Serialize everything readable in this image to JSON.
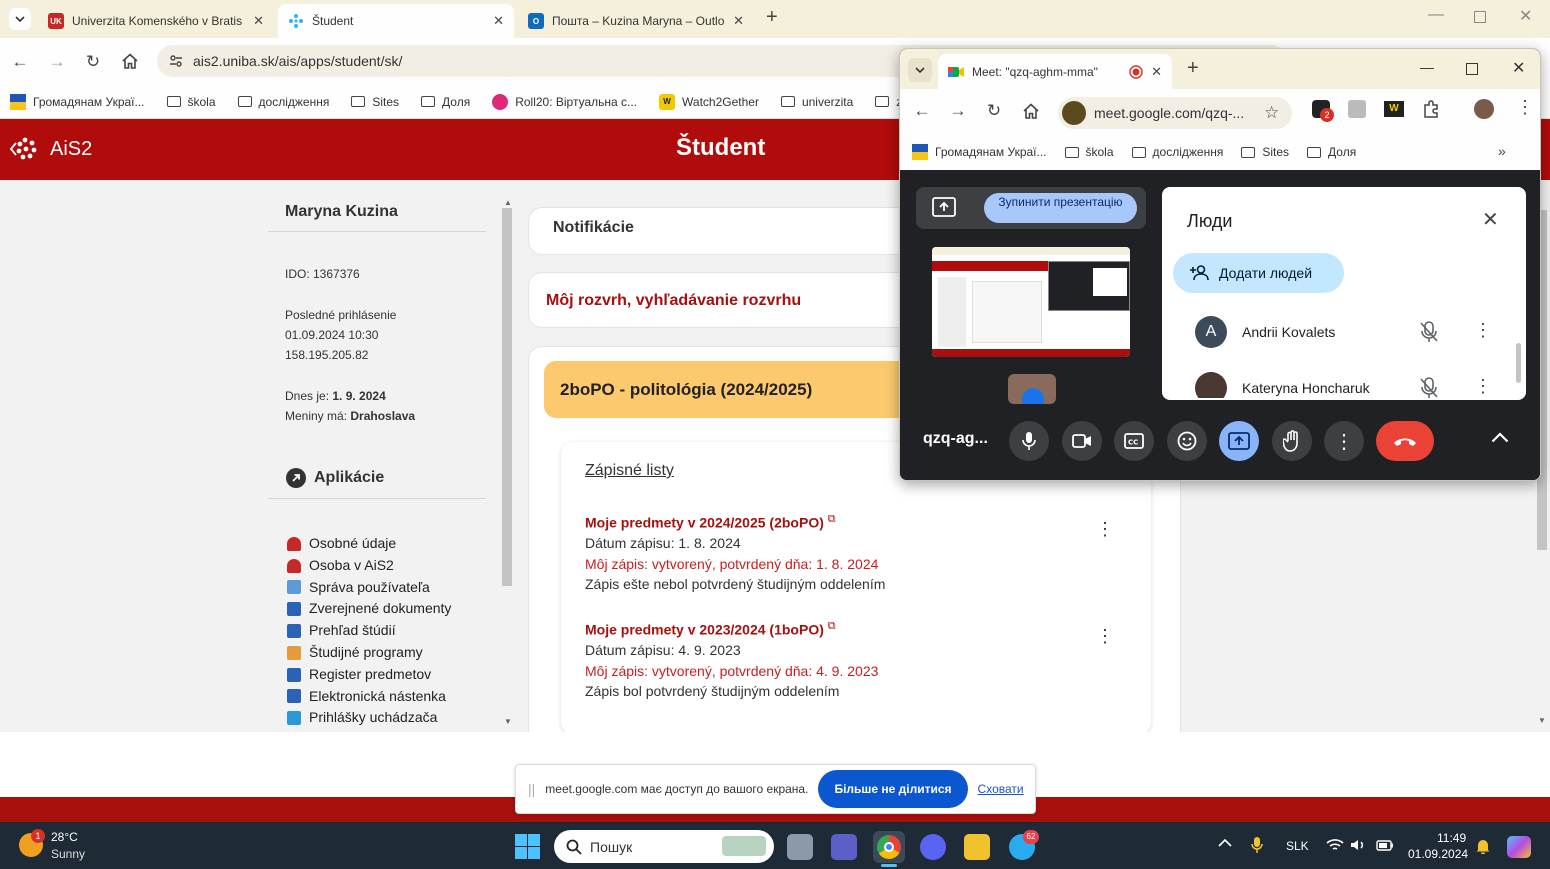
{
  "browser": {
    "tabs": [
      {
        "title": "Univerzita Komenského v Bratis",
        "favicon": "UK",
        "favicon_color": "#c62828"
      },
      {
        "title": "Študent",
        "favicon": "ais2-icon",
        "favicon_color": "#29b6f6"
      },
      {
        "title": "Пошта – Kuzina Maryna – Outlo",
        "favicon": "outlook-icon",
        "favicon_color": "#0f6cbd"
      }
    ],
    "url": "ais2.uniba.sk/ais/apps/student/sk/",
    "bookmarks": [
      "Громадянам Украї...",
      "škola",
      "дослідження",
      "Sites",
      "Доля",
      "Roll20: Віртуальна с...",
      "Watch2Gether",
      "univerzita",
      "zav"
    ]
  },
  "ais": {
    "logo": "AiS2",
    "header_title": "Študent",
    "user": {
      "name": "Maryna Kuzina",
      "ido": "IDO: 1367376",
      "last_login_label": "Posledné prihlásenie",
      "last_login_date": "01.09.2024 10:30",
      "last_login_ip": "158.195.205.82",
      "today_label": "Dnes je:",
      "today": "1. 9. 2024",
      "nameday_label": "Meniny má:",
      "nameday": "Drahoslava"
    },
    "apps_title": "Aplikácie",
    "apps": [
      {
        "label": "Osobné údaje",
        "color": "#c62828"
      },
      {
        "label": "Osoba v AiS2",
        "color": "#c62828"
      },
      {
        "label": "Správa používateľa",
        "color": "#5c9bd6"
      },
      {
        "label": "Zverejnené dokumenty",
        "color": "#2a63b5"
      },
      {
        "label": "Prehľad štúdií",
        "color": "#2a63b5"
      },
      {
        "label": "Študijné programy",
        "color": "#e69b3a"
      },
      {
        "label": "Register predmetov",
        "color": "#2a63b5"
      },
      {
        "label": "Elektronická nástenka",
        "color": "#2a63b5"
      },
      {
        "label": "Prihlášky uchádzača",
        "color": "#2a9ad6"
      }
    ],
    "notifications": "Notifikácie",
    "schedule_link": "Môj rozvrh, vyhľadávanie rozvrhu",
    "course": "2boPO - politológia (2024/2025)",
    "enrollment_title": "Zápisné listy",
    "enrollments": [
      {
        "heading": "Moje predmety v 2024/2025 (2boPO)",
        "date": "Dátum zápisu: 1. 8. 2024",
        "status": "Môj zápis: vytvorený, potvrdený dňa: 1. 8. 2024",
        "note": "Zápis ešte nebol potvrdený študijným oddelením"
      },
      {
        "heading": "Moje predmety v 2023/2024 (1boPO)",
        "date": "Dátum zápisu: 4. 9. 2023",
        "status": "Môj zápis: vytvorený, potvrdený dňa: 4. 9. 2023",
        "note": "Zápis bol potvrdený študijným oddelením"
      }
    ]
  },
  "share_bar": {
    "message": "meet.google.com має доступ до вашого екрана.",
    "stop_label": "Більше не ділитися",
    "hide_label": "Сховати"
  },
  "meet": {
    "tab_title": "Meet: \"qzq-aghm-mma\"",
    "url": "meet.google.com/qzq-...",
    "extension_badge": "2",
    "bookmarks": [
      "Громадянам Украї...",
      "škola",
      "дослідження",
      "Sites",
      "Доля"
    ],
    "stop_presenting": "Зупинити презентацію",
    "meeting_code": "qzq-ag...",
    "people_title": "Люди",
    "add_people": "Додати людей",
    "participants": [
      {
        "name": "Andrii Kovalets",
        "initial": "A",
        "avatar_color": "#3c4b5c"
      },
      {
        "name": "Kateryna Honcharuk",
        "initial": "",
        "avatar_color": "#4a3830"
      }
    ]
  },
  "taskbar": {
    "weather_temp": "28°C",
    "weather_desc": "Sunny",
    "weather_badge": "1",
    "search_placeholder": "Пошук",
    "telegram_badge": "62",
    "lang": "SLK",
    "time": "11:49",
    "date": "01.09.2024"
  }
}
